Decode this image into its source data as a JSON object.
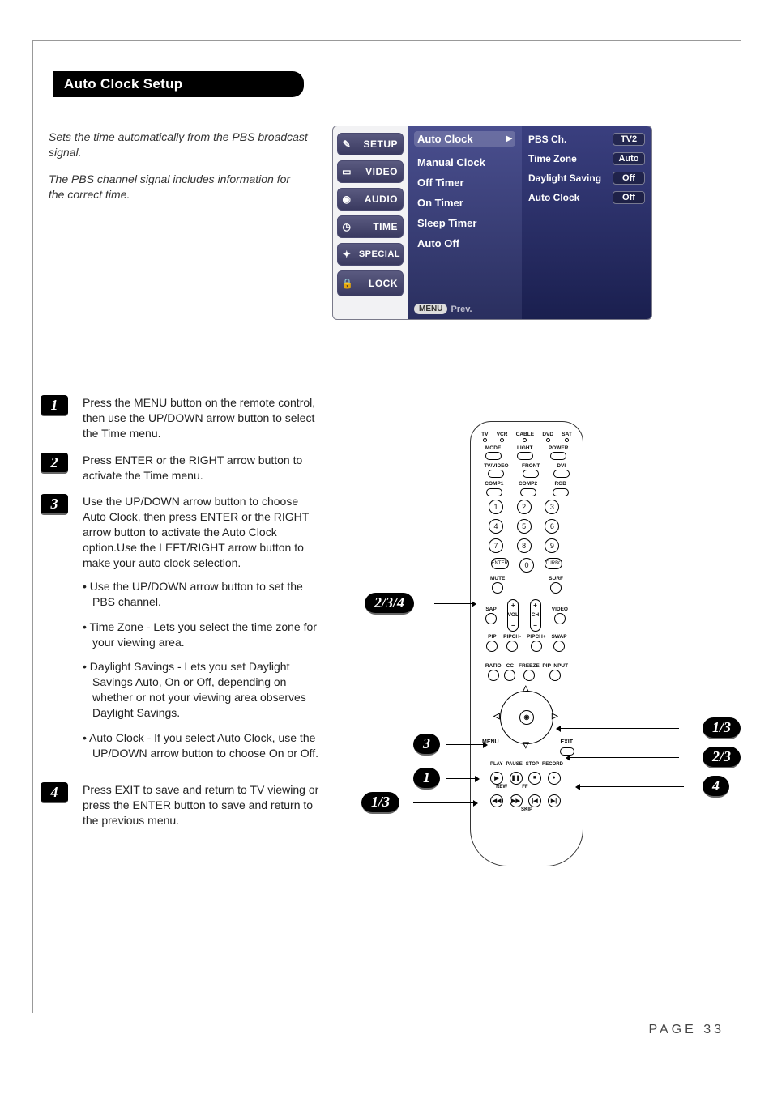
{
  "page_title": "Auto Clock Setup",
  "intro": [
    "Sets the time automatically from the PBS broadcast signal.",
    "The PBS channel signal includes information for the correct time."
  ],
  "osd": {
    "tabs": [
      "SETUP",
      "VIDEO",
      "AUDIO",
      "TIME",
      "SPECIAL",
      "LOCK"
    ],
    "mid": {
      "selected": {
        "label": "Auto Clock",
        "arrow": "▶"
      },
      "items": [
        "Manual Clock",
        "Off Timer",
        "On Timer",
        "Sleep Timer",
        "Auto Off"
      ],
      "footer_menu": "MENU",
      "footer_prev": "Prev."
    },
    "right": [
      {
        "label": "PBS Ch.",
        "value": "TV2"
      },
      {
        "label": "Time Zone",
        "value": "Auto"
      },
      {
        "label": "Daylight Saving",
        "value": "Off"
      },
      {
        "label": "Auto Clock",
        "value": "Off"
      }
    ]
  },
  "steps": [
    {
      "n": "1",
      "body": "Press the MENU button on the remote control, then use the UP/DOWN arrow button to select the Time menu."
    },
    {
      "n": "2",
      "body": "Press ENTER or the RIGHT arrow button to activate the Time menu."
    },
    {
      "n": "3",
      "body": "Use the UP/DOWN arrow button to choose Auto Clock, then press ENTER or the RIGHT arrow button to activate the Auto Clock option.Use the LEFT/RIGHT arrow button to make your auto clock selection.",
      "bullets": [
        "Use the UP/DOWN arrow button to set the PBS channel.",
        "Time Zone - Lets you select the time zone for your viewing area.",
        "Daylight Savings - Lets you set Daylight Savings Auto, On or Off, depending on whether or not your viewing area observes Daylight Savings.",
        "Auto Clock - If you select Auto Clock, use the UP/DOWN arrow button  to choose On or Off."
      ]
    },
    {
      "n": "4",
      "body": "Press EXIT to save and return to TV viewing or press the ENTER button to save and return to the previous menu."
    }
  ],
  "remote": {
    "top_modes": [
      "TV",
      "VCR",
      "CABLE",
      "DVD",
      "SAT"
    ],
    "row2": [
      "MODE",
      "LIGHT",
      "POWER"
    ],
    "row3": [
      "TV/VIDEO",
      "FRONT",
      "DVI"
    ],
    "row4": [
      "COMP1",
      "COMP2",
      "RGB"
    ],
    "digits": [
      "1",
      "2",
      "3",
      "4",
      "5",
      "6",
      "7",
      "8",
      "9",
      "0"
    ],
    "enter": "ENTER",
    "turbo": "TURBO",
    "mute": "MUTE",
    "surf": "SURF",
    "sap": "SAP",
    "video": "VIDEO",
    "vol": "VOL",
    "ch": "CH",
    "pip_row": [
      "PIP",
      "PIPCH-",
      "PIPCH+",
      "SWAP"
    ],
    "ratio_row": [
      "RATIO",
      "CC",
      "FREEZE",
      "PIP INPUT"
    ],
    "menu": "MENU",
    "exit": "EXIT",
    "transport_labels": [
      "PLAY",
      "PAUSE",
      "STOP",
      "RECORD",
      "REW",
      "FF",
      "",
      "",
      "",
      "",
      "SKIP",
      ""
    ],
    "transport_glyphs": [
      "▶",
      "❚❚",
      "■",
      "●",
      "◀◀",
      "▶▶",
      "|◀",
      "▶|"
    ]
  },
  "callouts": {
    "left_enter": "2/3/4",
    "left_dpad": "3",
    "left_menu_top": "1",
    "left_menu_bot": "1/3",
    "right_up": "1/3",
    "right_right": "2/3",
    "right_exit": "4"
  },
  "page_number": "PAGE 33"
}
